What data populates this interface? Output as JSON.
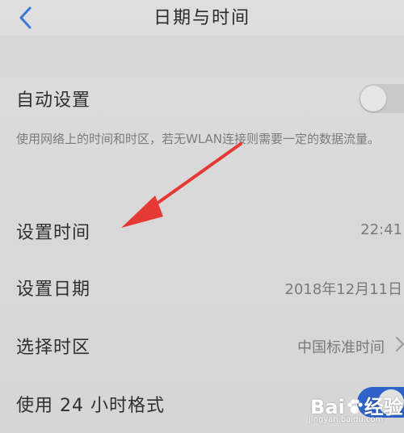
{
  "header": {
    "title": "日期与时间",
    "back_icon": "chevron-left-icon"
  },
  "settings": {
    "auto_set": {
      "label": "自动设置",
      "enabled": false
    },
    "auto_set_description": "使用网络上的时间和时区，若无WLAN连接则需要一定的数据流量。",
    "set_time": {
      "label": "设置时间",
      "value": "22:41"
    },
    "set_date": {
      "label": "设置日期",
      "value": "2018年12月11日"
    },
    "select_timezone": {
      "label": "选择时区",
      "value": "中国标准时间"
    },
    "use_24h": {
      "label": "使用 24 小时格式",
      "enabled": true
    }
  },
  "watermark": {
    "brand": "Bai",
    "brand_suffix": "经验",
    "url": "jingyan.baidu.com"
  },
  "colors": {
    "toggle_on": "#2f63c9",
    "toggle_off": "#c9c9c9",
    "arrow": "#e53935",
    "accent_back": "#3a78d8"
  }
}
